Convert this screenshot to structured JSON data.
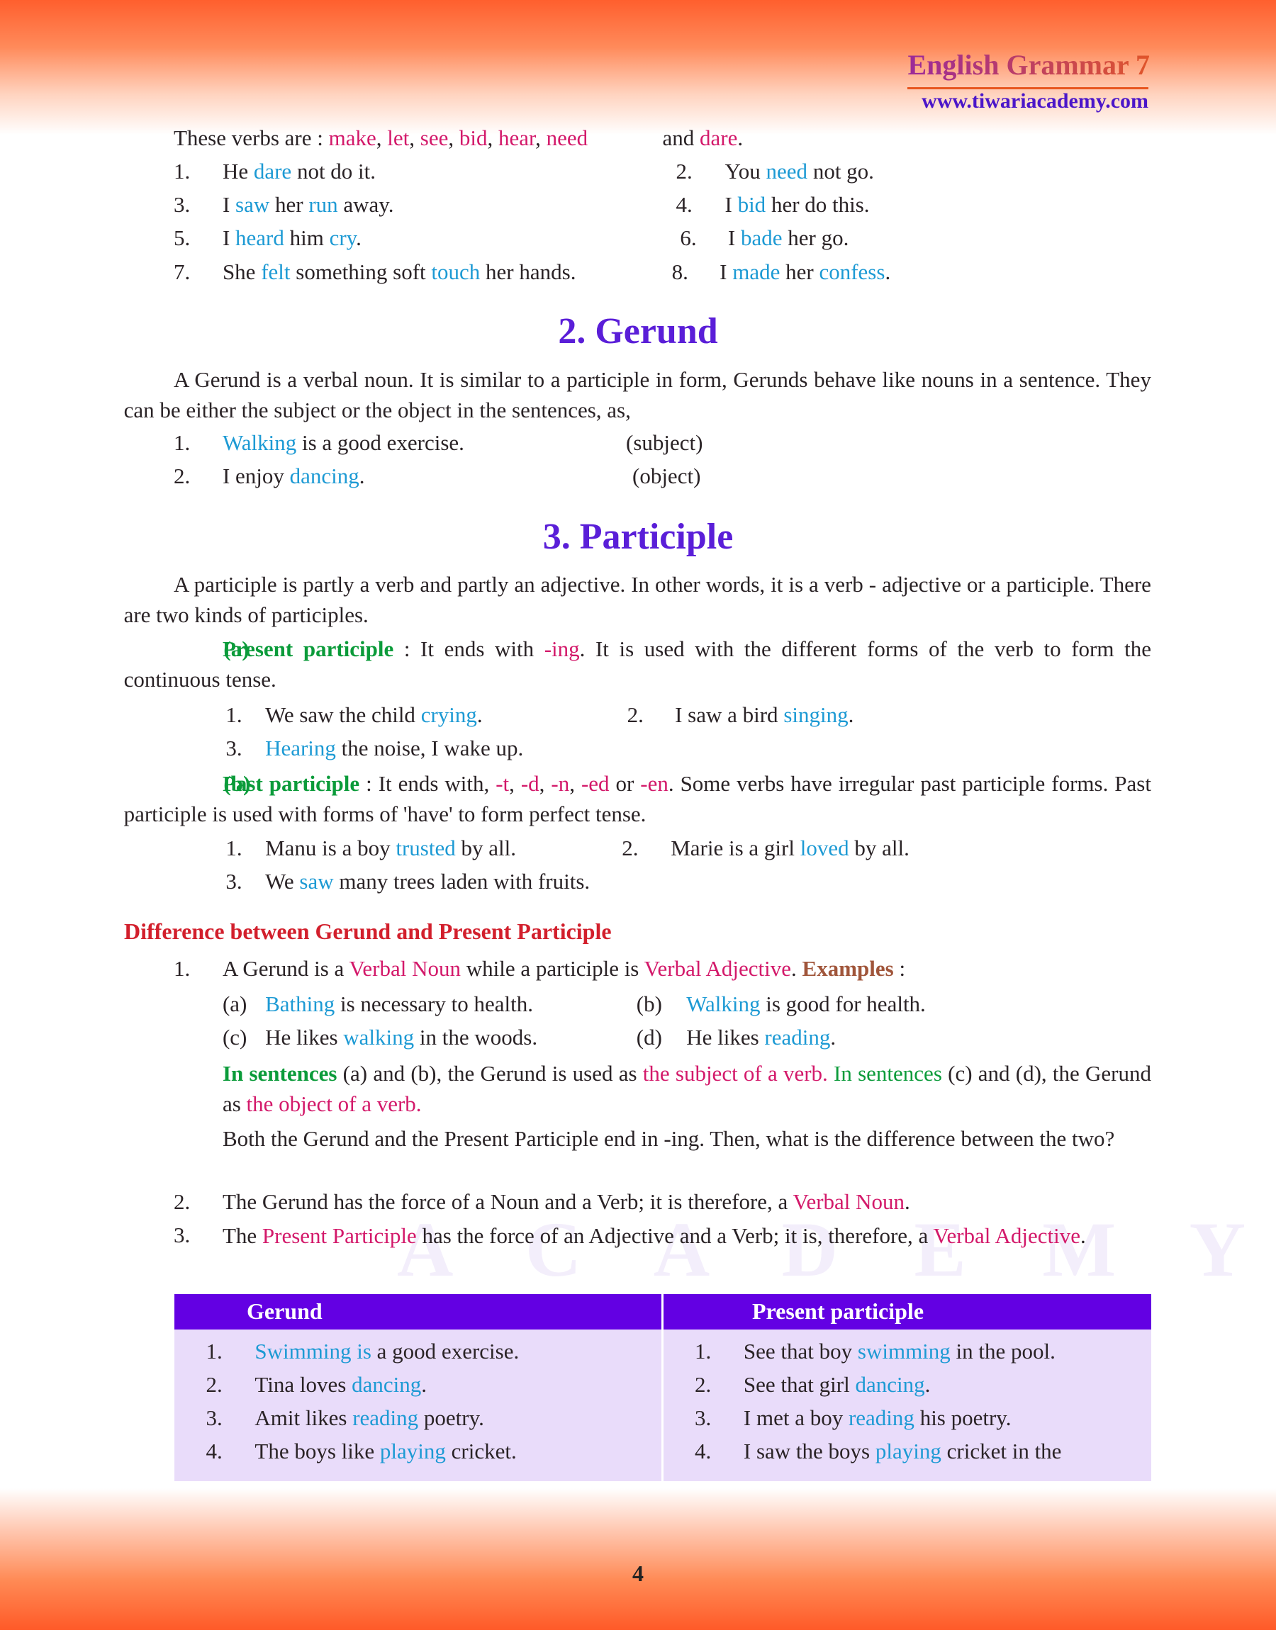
{
  "header": {
    "title": "English Grammar 7",
    "website": "www.tiwariacademy.com"
  },
  "watermark": "TIWARI ACADEMY",
  "colors": {
    "pink": "#d3196a",
    "blue": "#1d9ad4",
    "green": "#0b9b3a",
    "heading_purple": "#5a1ed8",
    "red_heading": "#d21f2c",
    "table_header": "#6300e3",
    "table_body": "#e9dcfa"
  },
  "verbs": {
    "line": {
      "s": [
        [
          "These verbs are : ",
          ""
        ],
        [
          "make",
          "p"
        ],
        [
          ", ",
          ""
        ],
        [
          "let",
          "p"
        ],
        [
          ", ",
          ""
        ],
        [
          "see",
          "p"
        ],
        [
          ", ",
          ""
        ],
        [
          "bid",
          "p"
        ],
        [
          ", ",
          ""
        ],
        [
          "hear",
          "p"
        ],
        [
          ", ",
          ""
        ],
        [
          "need",
          "p"
        ]
      ]
    },
    "line_end": {
      "s": [
        [
          "and ",
          ""
        ],
        [
          "dare",
          "p"
        ],
        [
          ".",
          ""
        ]
      ]
    },
    "examples": [
      {
        "n": "1.",
        "s": [
          [
            "He ",
            ""
          ],
          [
            "dare",
            "b"
          ],
          [
            " not do it.",
            ""
          ]
        ]
      },
      {
        "n": "2.",
        "s": [
          [
            "You ",
            ""
          ],
          [
            "need",
            "b"
          ],
          [
            " not go.",
            ""
          ]
        ]
      },
      {
        "n": "3.",
        "s": [
          [
            "I ",
            ""
          ],
          [
            "saw",
            "b"
          ],
          [
            " her ",
            ""
          ],
          [
            "run",
            "b"
          ],
          [
            " away.",
            ""
          ]
        ]
      },
      {
        "n": "4.",
        "s": [
          [
            "I ",
            ""
          ],
          [
            "bid",
            "b"
          ],
          [
            " her do this.",
            ""
          ]
        ]
      },
      {
        "n": "5.",
        "s": [
          [
            "I ",
            ""
          ],
          [
            "heard",
            "b"
          ],
          [
            " him ",
            ""
          ],
          [
            "cry",
            "b"
          ],
          [
            ".",
            ""
          ]
        ]
      },
      {
        "n": "6.",
        "s": [
          [
            "I ",
            ""
          ],
          [
            "bade",
            "b"
          ],
          [
            " her go.",
            ""
          ]
        ]
      },
      {
        "n": "7.",
        "s": [
          [
            "She ",
            ""
          ],
          [
            "felt",
            "b"
          ],
          [
            " something soft ",
            ""
          ],
          [
            "touch",
            "b"
          ],
          [
            " her hands.",
            ""
          ]
        ]
      },
      {
        "n": "8.",
        "s": [
          [
            "I ",
            ""
          ],
          [
            "made",
            "b"
          ],
          [
            " her ",
            ""
          ],
          [
            "confess",
            "b"
          ],
          [
            ".",
            ""
          ]
        ]
      }
    ]
  },
  "gerund": {
    "heading": "2. Gerund",
    "definition": {
      "s": [
        [
          "A Gerund is a verbal noun. It is similar to a participle in form, Gerunds behave like nouns in a sentence. They can be either the subject or the object in the sentences, as,",
          ""
        ]
      ]
    },
    "examples": [
      {
        "n": "1.",
        "s": [
          [
            "Walking",
            "b"
          ],
          [
            " is a good exercise.",
            ""
          ]
        ]
      },
      {
        "n": "2.",
        "s": [
          [
            "I enjoy ",
            ""
          ],
          [
            "dancing",
            "b"
          ],
          [
            ".",
            ""
          ]
        ]
      }
    ],
    "notes": [
      "(subject)",
      "(object)"
    ]
  },
  "participle": {
    "heading": "3. Participle",
    "definition": {
      "s": [
        [
          "A participle is partly a verb and partly an adjective. In other words, it is a verb - adjective or a participle. There are two kinds of participles.",
          ""
        ]
      ]
    },
    "present": {
      "s": [
        [
          "(a)",
          "gl"
        ],
        [
          "Present participle",
          "g"
        ],
        [
          " : It ends with ",
          ""
        ],
        [
          "-ing",
          "p"
        ],
        [
          ". It is used with the different forms of the verb to form the continuous tense.",
          ""
        ]
      ]
    },
    "present_examples": [
      {
        "n": "1.",
        "s": [
          [
            "We saw the child ",
            ""
          ],
          [
            "crying",
            "b"
          ],
          [
            ".",
            ""
          ]
        ]
      },
      {
        "n": "2.",
        "s": [
          [
            "I saw a bird ",
            ""
          ],
          [
            "singing",
            "b"
          ],
          [
            ".",
            ""
          ]
        ]
      },
      {
        "n": "3.",
        "s": [
          [
            "Hearing",
            "b"
          ],
          [
            " the noise, I wake up.",
            ""
          ]
        ]
      }
    ],
    "past": {
      "s": [
        [
          "(b)",
          "gl"
        ],
        [
          "Past participle",
          "g"
        ],
        [
          " : It ends with, ",
          ""
        ],
        [
          "-t",
          "p"
        ],
        [
          ", ",
          ""
        ],
        [
          "-d",
          "p"
        ],
        [
          ", ",
          ""
        ],
        [
          "-n",
          "p"
        ],
        [
          ", ",
          ""
        ],
        [
          "-ed",
          "p"
        ],
        [
          " or ",
          ""
        ],
        [
          "-en",
          "p"
        ],
        [
          ". Some verbs have irregular past participle forms. Past participle is used with forms of 'have' to form perfect tense.",
          ""
        ]
      ]
    },
    "past_examples": [
      {
        "n": "1.",
        "s": [
          [
            "Manu is a boy ",
            ""
          ],
          [
            "trusted",
            "b"
          ],
          [
            " by all.",
            ""
          ]
        ]
      },
      {
        "n": "2.",
        "s": [
          [
            "Marie is a girl ",
            ""
          ],
          [
            "loved",
            "b"
          ],
          [
            " by all.",
            ""
          ]
        ]
      },
      {
        "n": "3.",
        "s": [
          [
            "We ",
            ""
          ],
          [
            "saw",
            "b"
          ],
          [
            " many trees laden with fruits.",
            ""
          ]
        ]
      }
    ]
  },
  "difference": {
    "heading": "Difference between Gerund and Present Participle",
    "point1": {
      "n": "1.",
      "s": [
        [
          "A Gerund is a ",
          ""
        ],
        [
          "Verbal Noun",
          "p"
        ],
        [
          " while a participle is ",
          ""
        ],
        [
          "Verbal Adjective",
          "p"
        ],
        [
          ". ",
          ""
        ],
        [
          "Examples",
          "br"
        ],
        [
          " :",
          ""
        ]
      ]
    },
    "examples": [
      {
        "n": "(a)",
        "s": [
          [
            "Bathing",
            "b"
          ],
          [
            " is necessary to health.",
            ""
          ]
        ]
      },
      {
        "n": "(b)",
        "s": [
          [
            "Walking",
            "b"
          ],
          [
            " is good for health.",
            ""
          ]
        ]
      },
      {
        "n": "(c)",
        "s": [
          [
            "He likes ",
            ""
          ],
          [
            "walking",
            "b"
          ],
          [
            " in the woods.",
            ""
          ]
        ]
      },
      {
        "n": "(d)",
        "s": [
          [
            "He likes ",
            ""
          ],
          [
            "reading",
            "b"
          ],
          [
            ".",
            ""
          ]
        ]
      }
    ],
    "explanation": {
      "s": [
        [
          "In sentences",
          "g"
        ],
        [
          " (a) and (b), the Gerund is used as ",
          ""
        ],
        [
          "the subject of a verb.",
          "p"
        ],
        [
          " ",
          ""
        ],
        [
          "In sentences",
          "gn"
        ],
        [
          " (c) and (d), the Gerund as ",
          ""
        ],
        [
          "the object of a verb.",
          "p"
        ]
      ]
    },
    "question": {
      "s": [
        [
          "Both the Gerund and the Present Participle end in -ing. Then, what is the difference between the two?",
          ""
        ]
      ]
    },
    "point2": {
      "n": "2.",
      "s": [
        [
          "The Gerund has the force of a Noun and a Verb; it is therefore, a ",
          ""
        ],
        [
          "Verbal Noun",
          "p"
        ],
        [
          ".",
          ""
        ]
      ]
    },
    "point3": {
      "n": "3.",
      "s": [
        [
          "The ",
          ""
        ],
        [
          "Present Participle",
          "p"
        ],
        [
          " has the force of an Adjective and a Verb; it is, therefore, a ",
          ""
        ],
        [
          "Verbal Adjective",
          "p"
        ],
        [
          ".",
          ""
        ]
      ]
    }
  },
  "table": {
    "headers": [
      "Gerund",
      "Present participle"
    ],
    "gerund_rows": [
      {
        "n": "1.",
        "s": [
          [
            "Swimming is",
            "b"
          ],
          [
            " a good exercise.",
            ""
          ]
        ]
      },
      {
        "n": "2.",
        "s": [
          [
            "Tina loves ",
            ""
          ],
          [
            "dancing",
            "b"
          ],
          [
            ".",
            ""
          ]
        ]
      },
      {
        "n": "3.",
        "s": [
          [
            "Amit likes ",
            ""
          ],
          [
            "reading",
            "b"
          ],
          [
            " poetry.",
            ""
          ]
        ]
      },
      {
        "n": "4.",
        "s": [
          [
            "The boys like ",
            ""
          ],
          [
            "playing",
            "b"
          ],
          [
            " cricket.",
            ""
          ]
        ]
      }
    ],
    "participle_rows": [
      {
        "n": "1.",
        "s": [
          [
            "See that boy ",
            ""
          ],
          [
            "swimming",
            "b"
          ],
          [
            " in the pool.",
            ""
          ]
        ]
      },
      {
        "n": "2.",
        "s": [
          [
            "See that girl ",
            ""
          ],
          [
            "dancing",
            "b"
          ],
          [
            ".",
            ""
          ]
        ]
      },
      {
        "n": "3.",
        "s": [
          [
            "I met a boy ",
            ""
          ],
          [
            "reading",
            "b"
          ],
          [
            " his poetry.",
            ""
          ]
        ]
      },
      {
        "n": "4.",
        "s": [
          [
            "I saw the boys ",
            ""
          ],
          [
            "playing",
            "b"
          ],
          [
            " cricket in the",
            ""
          ]
        ]
      }
    ]
  },
  "page_number": "4"
}
